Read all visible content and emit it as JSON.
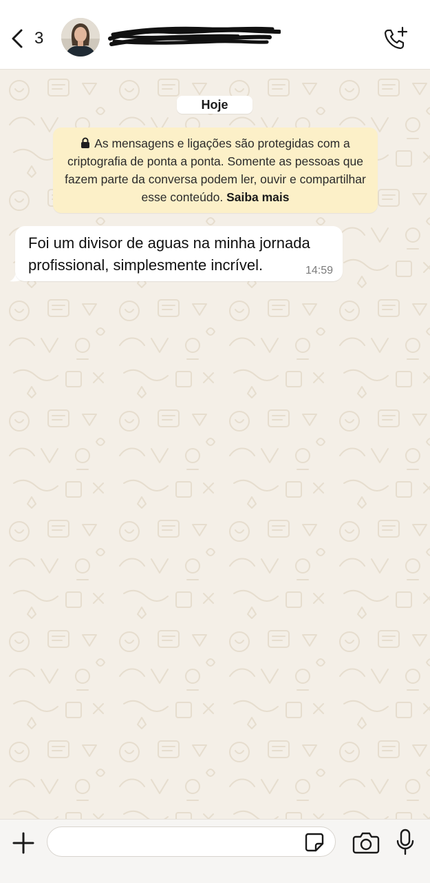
{
  "header": {
    "back_count": "3",
    "contact_name": "",
    "back_icon": "chevron-left-icon",
    "call_icon": "phone-plus-icon"
  },
  "chat": {
    "date_label": "Hoje",
    "encryption_notice": {
      "text": "As mensagens e ligações são protegidas com a criptografia de ponta a ponta. Somente as pessoas que fazem parte da conversa podem ler, ouvir e compartilhar esse conteúdo.",
      "link": "Saiba mais",
      "background": "#fcf0c8"
    },
    "messages": [
      {
        "text": "Foi um divisor de aguas na minha jornada profissional, simplesmente incrível.",
        "time": "14:59",
        "direction": "incoming"
      }
    ]
  },
  "composer": {
    "message_value": "",
    "plus_icon": "plus-icon",
    "sticker_icon": "sticker-icon",
    "camera_icon": "camera-icon",
    "mic_icon": "microphone-icon"
  },
  "colors": {
    "wallpaper": "#f4efe7",
    "bubble": "#ffffff",
    "notice": "#fcf0c8"
  }
}
